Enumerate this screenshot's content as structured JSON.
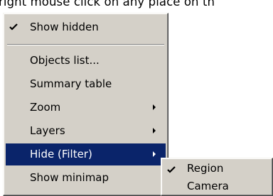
{
  "caption": "right mouse click on any place on th",
  "context_menu": {
    "items": [
      {
        "label": "Show hidden",
        "checked": true
      },
      {
        "label": "Objects list..."
      },
      {
        "label": "Summary table"
      },
      {
        "label": "Zoom",
        "submenu": true
      },
      {
        "label": "Layers",
        "submenu": true
      },
      {
        "label": "Hide (Filter)",
        "submenu": true,
        "highlighted": true
      },
      {
        "label": "Show minimap"
      }
    ]
  },
  "submenu": {
    "items": [
      {
        "label": "Region",
        "checked": true
      },
      {
        "label": "Camera"
      }
    ]
  },
  "colors": {
    "menu_face": "#d4d0c8",
    "highlight": "#0a246a",
    "highlight_text": "#ffffff"
  },
  "icons": [
    "checkmark-icon",
    "submenu-arrow-icon"
  ]
}
